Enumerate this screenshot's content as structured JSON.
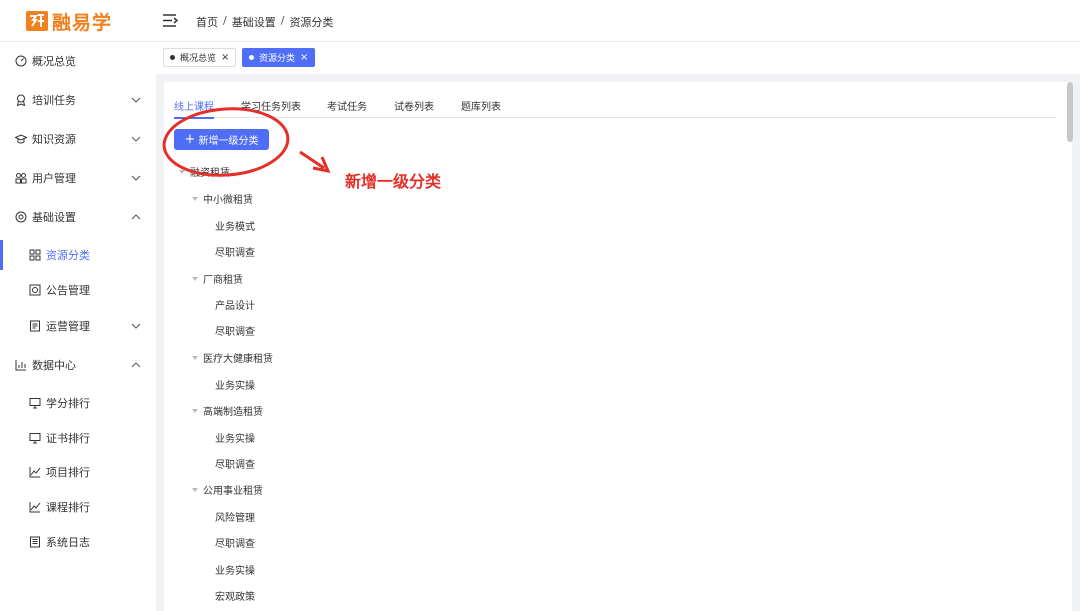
{
  "app": {
    "logo_text": "融易学",
    "brand_color": "#f2801f",
    "accent_color": "#4f6ef7"
  },
  "header": {
    "breadcrumb": [
      "首页",
      "基础设置",
      "资源分类"
    ],
    "separator": "/"
  },
  "sidebar": {
    "items": [
      {
        "label": "概况总览",
        "icon": "dashboard-icon",
        "expandable": false
      },
      {
        "label": "培训任务",
        "icon": "award-icon",
        "expandable": true,
        "expanded": false
      },
      {
        "label": "知识资源",
        "icon": "graduation-cap-icon",
        "expandable": true,
        "expanded": false
      },
      {
        "label": "用户管理",
        "icon": "users-icon",
        "expandable": true,
        "expanded": false
      },
      {
        "label": "基础设置",
        "icon": "settings-icon",
        "expandable": true,
        "expanded": true
      },
      {
        "label": "资源分类",
        "icon": "grid-icon",
        "sub": true,
        "active": true
      },
      {
        "label": "公告管理",
        "icon": "notice-icon",
        "sub": true
      },
      {
        "label": "运营管理",
        "icon": "document-icon",
        "sub": true,
        "expandable": true,
        "expanded": false
      },
      {
        "label": "数据中心",
        "icon": "bar-chart-icon",
        "expandable": true,
        "expanded": true
      },
      {
        "label": "学分排行",
        "icon": "monitor-icon",
        "sub": true
      },
      {
        "label": "证书排行",
        "icon": "monitor-icon",
        "sub": true
      },
      {
        "label": "项目排行",
        "icon": "line-chart-icon",
        "sub": true
      },
      {
        "label": "课程排行",
        "icon": "line-chart-icon",
        "sub": true
      },
      {
        "label": "系统日志",
        "icon": "log-icon",
        "sub": true
      }
    ]
  },
  "tags": [
    {
      "label": "概况总览",
      "active": false,
      "close": "×"
    },
    {
      "label": "资源分类",
      "active": true,
      "close": "×"
    }
  ],
  "tabs": [
    {
      "label": "线上课程",
      "active": true
    },
    {
      "label": "学习任务列表",
      "active": false
    },
    {
      "label": "考试任务",
      "active": false
    },
    {
      "label": "试卷列表",
      "active": false
    },
    {
      "label": "题库列表",
      "active": false
    }
  ],
  "toolbar": {
    "add_label": "新增一级分类",
    "add_icon": "+"
  },
  "tree": [
    {
      "label": "融资租赁",
      "level": 0,
      "expanded": true
    },
    {
      "label": "中小微租赁",
      "level": 1,
      "expanded": true
    },
    {
      "label": "业务模式",
      "level": 2
    },
    {
      "label": "尽职调查",
      "level": 2
    },
    {
      "label": "厂商租赁",
      "level": 1,
      "expanded": true
    },
    {
      "label": "产品设计",
      "level": 2
    },
    {
      "label": "尽职调查",
      "level": 2
    },
    {
      "label": "医疗大健康租赁",
      "level": 1,
      "expanded": true
    },
    {
      "label": "业务实操",
      "level": 2
    },
    {
      "label": "高端制造租赁",
      "level": 1,
      "expanded": true
    },
    {
      "label": "业务实操",
      "level": 2
    },
    {
      "label": "尽职调查",
      "level": 2
    },
    {
      "label": "公用事业租赁",
      "level": 1,
      "expanded": true
    },
    {
      "label": "风险管理",
      "level": 2
    },
    {
      "label": "尽职调查",
      "level": 2
    },
    {
      "label": "业务实操",
      "level": 2
    },
    {
      "label": "宏观政策",
      "level": 2
    }
  ],
  "annotation": {
    "label": "新增一级分类",
    "color": "#e5302a"
  }
}
